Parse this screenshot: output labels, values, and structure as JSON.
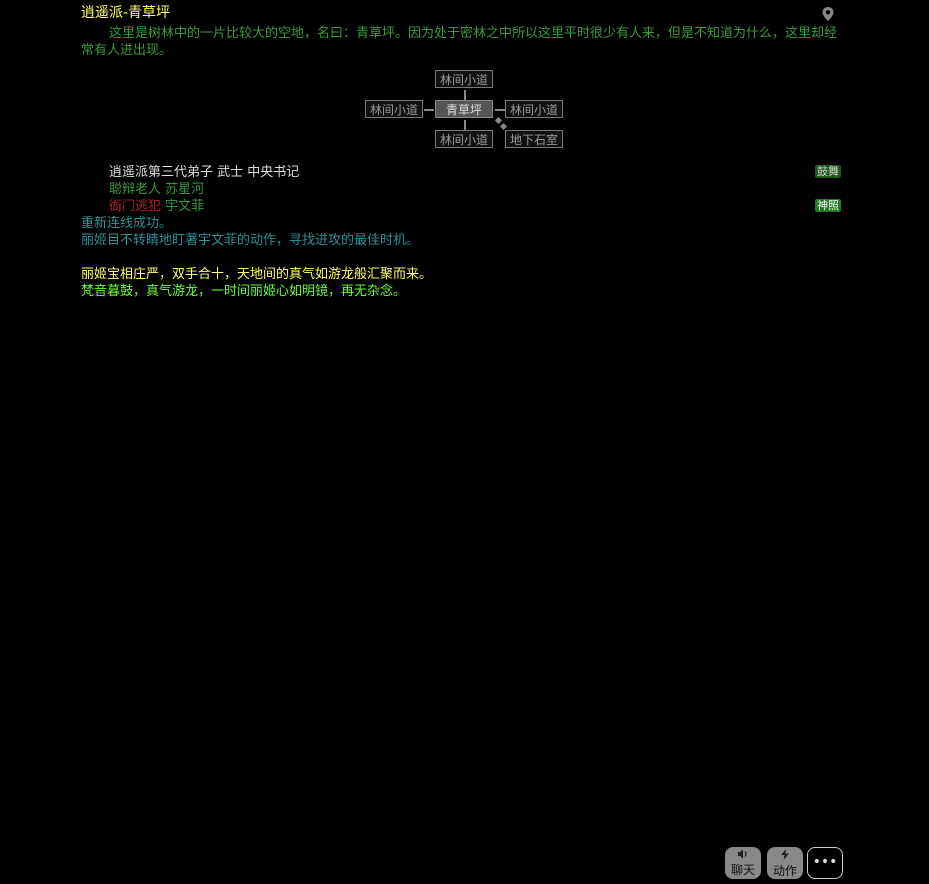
{
  "room": {
    "title": "逍遥派-青草坪",
    "description": "这里是树林中的一片比较大的空地，名曰：青草坪。因为处于密林之中所以这里平时很少有人来，但是不知道为什么，这里却经常有人进出现。"
  },
  "icons": {
    "location": "map-pin-icon",
    "chat": "speaker-icon",
    "action": "lightning-icon",
    "more": "ellipsis-icon"
  },
  "map": {
    "north": "林间小道",
    "west": "林间小道",
    "current": "青草坪",
    "east": "林间小道",
    "south": "林间小道",
    "southeast": "地下石室"
  },
  "npcs": [
    {
      "text": "逍遥派第三代弟子 武士 中央书记",
      "button": "鼓舞"
    },
    {
      "title": "聪辩老人",
      "name": "苏星河"
    },
    {
      "title": "衙门逃犯",
      "name": "宇文菲",
      "button": "神照"
    }
  ],
  "log": [
    {
      "text": "重新连线成功。",
      "color": "cyan"
    },
    {
      "text": "丽姬目不转睛地盯著宇文菲的动作，寻找进攻的最佳时机。",
      "color": "cyan"
    },
    {
      "text": "",
      "color": "cyan"
    },
    {
      "text": "丽姬宝相庄严，双手合十，天地间的真气如游龙般汇聚而来。",
      "color": "yellow"
    },
    {
      "text": "梵音暮鼓，真气游龙，一时间丽姬心如明镜，再无杂念。",
      "color": "lime"
    }
  ],
  "bottom": {
    "chat_label": "聊天",
    "action_label": "动作",
    "more_label": "•••"
  }
}
